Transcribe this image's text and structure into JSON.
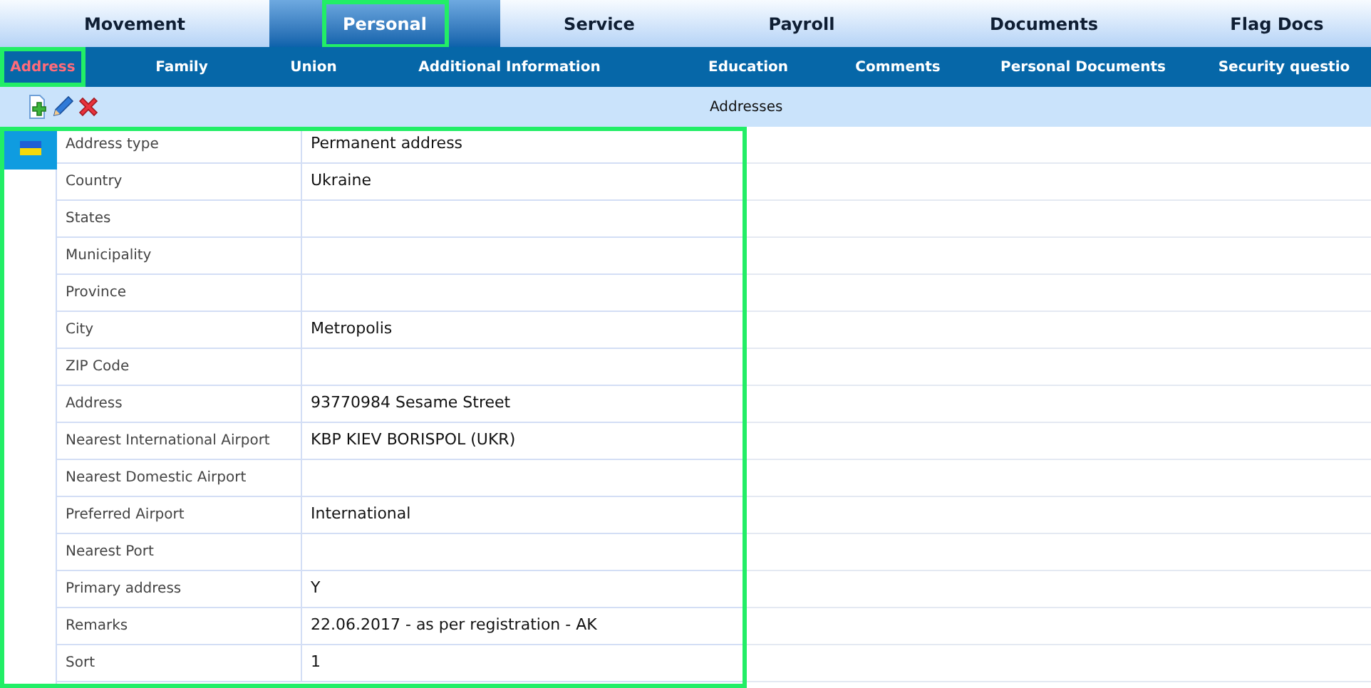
{
  "tabs": [
    {
      "label": "Movement",
      "selected": false,
      "highlighted": false
    },
    {
      "label": "Personal",
      "selected": true,
      "highlighted": true
    },
    {
      "label": "Service",
      "selected": false,
      "highlighted": false
    },
    {
      "label": "Payroll",
      "selected": false,
      "highlighted": false
    },
    {
      "label": "Documents",
      "selected": false,
      "highlighted": false
    },
    {
      "label": "Flag Docs",
      "selected": false,
      "highlighted": false
    }
  ],
  "subtabs": [
    {
      "label": "Address",
      "selected": true,
      "highlighted": true
    },
    {
      "label": "Family",
      "selected": false,
      "highlighted": false
    },
    {
      "label": "Union",
      "selected": false,
      "highlighted": false
    },
    {
      "label": "Additional Information",
      "selected": false,
      "highlighted": false
    },
    {
      "label": "Education",
      "selected": false,
      "highlighted": false
    },
    {
      "label": "Comments",
      "selected": false,
      "highlighted": false
    },
    {
      "label": "Personal Documents",
      "selected": false,
      "highlighted": false
    },
    {
      "label": "Security questio",
      "selected": false,
      "highlighted": false
    }
  ],
  "toolbar": {
    "title": "Addresses"
  },
  "record": {
    "selected": true,
    "highlighted": true,
    "fields": [
      {
        "label": "Address type",
        "value": "Permanent address"
      },
      {
        "label": "Country",
        "value": "Ukraine"
      },
      {
        "label": "States"
      },
      {
        "label": "Municipality"
      },
      {
        "label": "Province"
      },
      {
        "label": "City",
        "value": "Metropolis"
      },
      {
        "label": "ZIP Code"
      },
      {
        "label": "Address",
        "value": "93770984 Sesame Street"
      },
      {
        "label": "Nearest International Airport",
        "value": "KBP KIEV BORISPOL (UKR)"
      },
      {
        "label": "Nearest Domestic Airport"
      },
      {
        "label": "Preferred Airport",
        "value": "International"
      },
      {
        "label": "Nearest Port"
      },
      {
        "label": "Primary address",
        "value": "Y"
      },
      {
        "label": "Remarks",
        "value": "22.06.2017 - as per registration - AK"
      },
      {
        "label": "Sort",
        "value": "1"
      }
    ]
  }
}
